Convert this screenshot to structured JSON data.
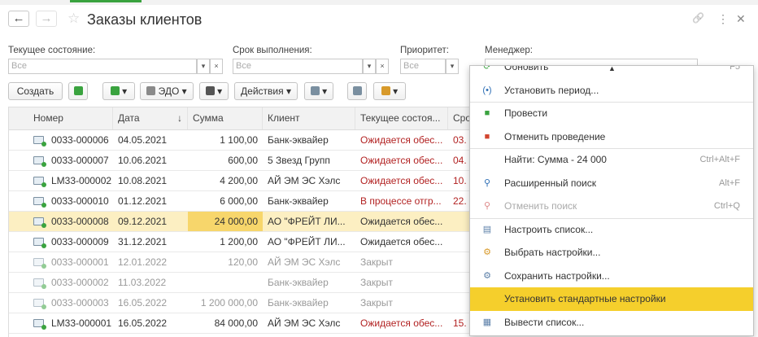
{
  "window": {
    "title": "Заказы клиентов",
    "back_glyph": "←",
    "forward_glyph": "→",
    "star_glyph": "☆",
    "link_glyph": "🔗",
    "more_glyph": "⋮",
    "close_glyph": "✕"
  },
  "filters": {
    "state": {
      "label": "Текущее состояние:",
      "value": "Все"
    },
    "deadline": {
      "label": "Срок выполнения:",
      "value": "Все"
    },
    "priority": {
      "label": "Приоритет:",
      "value": "Все"
    },
    "manager": {
      "label": "Менеджер:"
    },
    "dropdown_glyph": "▾",
    "clear_glyph": "×"
  },
  "toolbar": {
    "create": "Создать",
    "edo": "ЭДО",
    "actions": "Действия",
    "arrow": "▾"
  },
  "table": {
    "columns": [
      "Номер",
      "Дата",
      "Сумма",
      "Клиент",
      "Текущее состоя...",
      "Сро"
    ],
    "sort_glyph": "↓",
    "rows": [
      {
        "number": "0033-000006",
        "date": "04.05.2021",
        "sum": "1 100,00",
        "client": "Банк-эквайер",
        "state": "Ожидается обес...",
        "term": "03.",
        "state_color": "#b22222",
        "closed": false,
        "selected": false
      },
      {
        "number": "0033-000007",
        "date": "10.06.2021",
        "sum": "600,00",
        "client": "5 Звезд Групп",
        "state": "Ожидается обес...",
        "term": "04.",
        "state_color": "#b22222",
        "closed": false,
        "selected": false
      },
      {
        "number": "LM33-000002",
        "date": "10.08.2021",
        "sum": "4 200,00",
        "client": "АЙ ЭМ ЭС Хэлс",
        "state": "Ожидается обес...",
        "term": "10.",
        "state_color": "#b22222",
        "closed": false,
        "selected": false
      },
      {
        "number": "0033-000010",
        "date": "01.12.2021",
        "sum": "6 000,00",
        "client": "Банк-эквайер",
        "state": "В процессе отгр...",
        "term": "22.",
        "state_color": "#b22222",
        "closed": false,
        "selected": false
      },
      {
        "number": "0033-000008",
        "date": "09.12.2021",
        "sum": "24 000,00",
        "client": "АО \"ФРЕЙТ ЛИ...",
        "state": "Ожидается обес...",
        "term": "",
        "state_color": "#333333",
        "closed": false,
        "selected": true
      },
      {
        "number": "0033-000009",
        "date": "31.12.2021",
        "sum": "1 200,00",
        "client": "АО \"ФРЕЙТ ЛИ...",
        "state": "Ожидается обес...",
        "term": "",
        "state_color": "#333333",
        "closed": false,
        "selected": false
      },
      {
        "number": "0033-000001",
        "date": "12.01.2022",
        "sum": "120,00",
        "client": "АЙ ЭМ ЭС Хэлс",
        "state": "Закрыт",
        "term": "",
        "state_color": "#9a9a9a",
        "closed": true,
        "selected": false
      },
      {
        "number": "0033-000002",
        "date": "11.03.2022",
        "sum": "",
        "client": "Банк-эквайер",
        "state": "Закрыт",
        "term": "",
        "state_color": "#9a9a9a",
        "closed": true,
        "selected": false
      },
      {
        "number": "0033-000003",
        "date": "16.05.2022",
        "sum": "1 200 000,00",
        "client": "Банк-эквайер",
        "state": "Закрыт",
        "term": "",
        "state_color": "#9a9a9a",
        "closed": true,
        "selected": false
      },
      {
        "number": "LM33-000001",
        "date": "16.05.2022",
        "sum": "84 000,00",
        "client": "АЙ ЭМ ЭС Хэлс",
        "state": "Ожидается обес...",
        "term": "15.",
        "state_color": "#b22222",
        "closed": false,
        "selected": false
      }
    ]
  },
  "context_menu": {
    "scroll_up_glyph": "▲",
    "items": [
      {
        "label": "Обновить",
        "shortcut": "F5",
        "icon": "refresh-icon",
        "glyph": "⟳",
        "color": "#3aa33f",
        "disabled": false,
        "highlight": false
      },
      {
        "label": "Установить период...",
        "shortcut": "",
        "icon": "period-icon",
        "glyph": "(•)",
        "color": "#2e6fb5",
        "disabled": false,
        "highlight": false
      },
      {
        "label": "Провести",
        "shortcut": "",
        "icon": "post-icon",
        "glyph": "■",
        "color": "#3aa33f",
        "disabled": false,
        "highlight": false
      },
      {
        "label": "Отменить проведение",
        "shortcut": "",
        "icon": "unpost-icon",
        "glyph": "■",
        "color": "#d2452f",
        "disabled": false,
        "highlight": false
      },
      {
        "label": "Найти: Сумма - 24 000",
        "shortcut": "Ctrl+Alt+F",
        "icon": "",
        "glyph": "",
        "color": "#333333",
        "disabled": false,
        "highlight": false
      },
      {
        "label": "Расширенный поиск",
        "shortcut": "Alt+F",
        "icon": "advanced-search-icon",
        "glyph": "⚲",
        "color": "#2e6fb5",
        "disabled": false,
        "highlight": false
      },
      {
        "label": "Отменить поиск",
        "shortcut": "Ctrl+Q",
        "icon": "cancel-search-icon",
        "glyph": "⚲",
        "color": "#d88",
        "disabled": true,
        "highlight": false
      },
      {
        "label": "Настроить список...",
        "shortcut": "",
        "icon": "configure-list-icon",
        "glyph": "▤",
        "color": "#5b7fa8",
        "disabled": false,
        "highlight": false
      },
      {
        "label": "Выбрать настройки...",
        "shortcut": "",
        "icon": "choose-settings-icon",
        "glyph": "⚙",
        "color": "#d89a2b",
        "disabled": false,
        "highlight": false
      },
      {
        "label": "Сохранить настройки...",
        "shortcut": "",
        "icon": "save-settings-icon",
        "glyph": "⚙",
        "color": "#5b7fa8",
        "disabled": false,
        "highlight": false
      },
      {
        "label": "Установить стандартные настройки",
        "shortcut": "",
        "icon": "",
        "glyph": "",
        "color": "#333333",
        "disabled": false,
        "highlight": true
      },
      {
        "label": "Вывести список...",
        "shortcut": "",
        "icon": "output-list-icon",
        "glyph": "▦",
        "color": "#5b7fa8",
        "disabled": false,
        "highlight": false
      }
    ]
  },
  "colors": {
    "accent_green": "#3aa33f",
    "selection_row": "#fcefc2",
    "selection_cell": "#f7d66b",
    "menu_highlight": "#f5cf2c"
  }
}
